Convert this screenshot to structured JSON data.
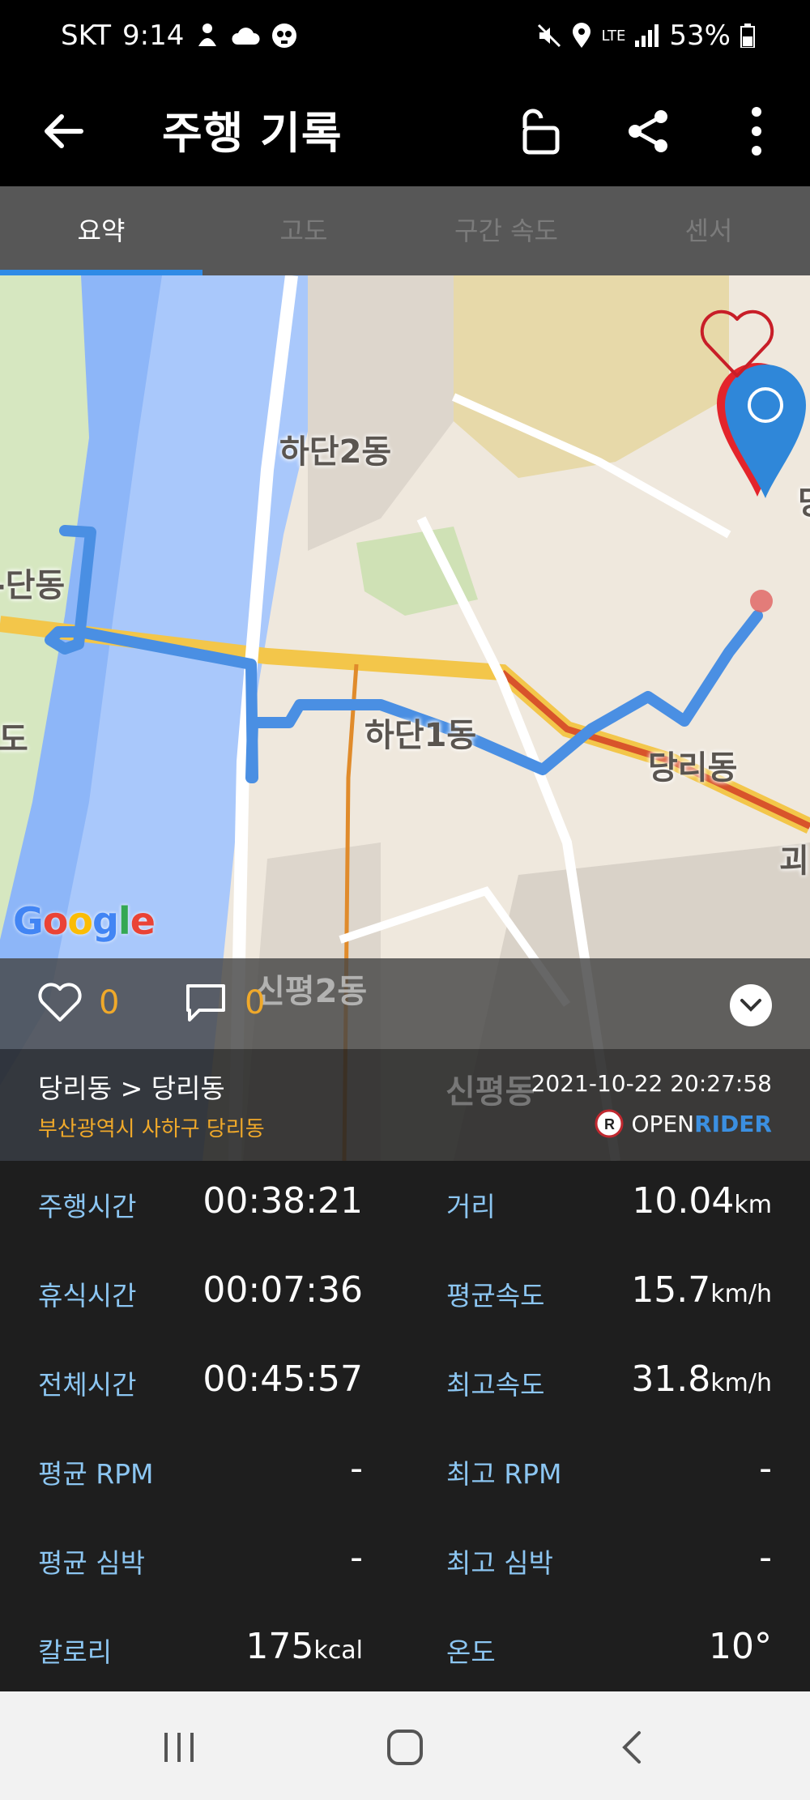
{
  "status_bar": {
    "carrier": "SKT",
    "time": "9:14",
    "network": "LTE",
    "battery": "53%"
  },
  "app_bar": {
    "title": "주행 기록"
  },
  "tabs": [
    {
      "label": "요약",
      "active": true
    },
    {
      "label": "고도",
      "active": false
    },
    {
      "label": "구간 속도",
      "active": false
    },
    {
      "label": "센서",
      "active": false
    }
  ],
  "map": {
    "labels": {
      "hadan2": "하단2동",
      "hadan_left": "-단동",
      "hadan1": "하단1동",
      "dangni": "당리동",
      "sinpyeong2": "신평2동",
      "sinpyeong": "신평동",
      "do_left": "도",
      "goe_right": "괴",
      "dang_right": "당"
    },
    "attribution": "Google",
    "route_color": "#4a8fe3"
  },
  "social": {
    "likes": "0",
    "comments": "0"
  },
  "ride": {
    "route": "당리동 > 당리동",
    "address": "부산광역시 사하구 당리동",
    "datetime": "2021-10-22 20:27:58",
    "brand_open": "OPEN",
    "brand_rider": "RIDER"
  },
  "stats": {
    "ride_time_label": "주행시간",
    "ride_time": "00:38:21",
    "distance_label": "거리",
    "distance": "10.04",
    "distance_unit": "km",
    "rest_time_label": "휴식시간",
    "rest_time": "00:07:36",
    "avg_speed_label": "평균속도",
    "avg_speed": "15.7",
    "speed_unit": "km/h",
    "total_time_label": "전체시간",
    "total_time": "00:45:57",
    "max_speed_label": "최고속도",
    "max_speed": "31.8",
    "avg_rpm_label": "평균 RPM",
    "avg_rpm": "-",
    "max_rpm_label": "최고 RPM",
    "max_rpm": "-",
    "avg_hr_label": "평균 심박",
    "avg_hr": "-",
    "max_hr_label": "최고 심박",
    "max_hr": "-",
    "calories_label": "칼로리",
    "calories": "175",
    "calories_unit": "kcal",
    "temp_label": "온도",
    "temp": "10°"
  },
  "colors": {
    "accent_blue": "#2f8be6",
    "label_blue": "#8cc6f2",
    "count_orange": "#f0a92a"
  }
}
